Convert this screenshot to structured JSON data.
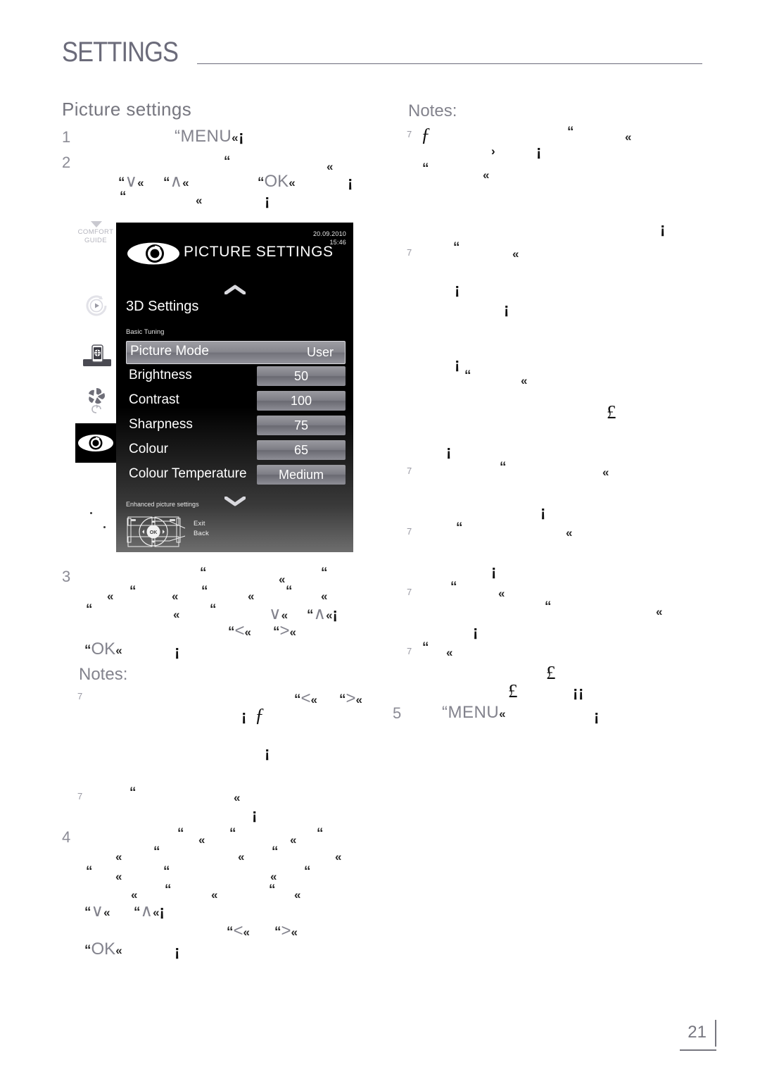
{
  "header": {
    "title": "SETTINGS",
    "rule": "horizontal-rule"
  },
  "section": {
    "heading": "Picture settings"
  },
  "page_number": "21",
  "left_column": {
    "steps": [
      "1",
      "2",
      "3",
      "4"
    ],
    "notes_label": "Notes:",
    "keys": {
      "menu": "MENU",
      "ok": "OK",
      "down": "∨",
      "up": "∧",
      "left": "<",
      "right": ">"
    },
    "glyphs": {
      "quote_open": "“",
      "quote_close": "«",
      "inverted_exclam": "¡",
      "note_marker": "7",
      "florin": "ƒ"
    }
  },
  "right_column": {
    "notes_label": "Notes:",
    "steps": [
      "5"
    ],
    "keys": {
      "menu": "MENU"
    },
    "glyphs": {
      "quote_open": "“",
      "quote_close": "«",
      "inverted_exclam": "¡",
      "note_marker": "7",
      "florin": "ƒ",
      "pound": "£",
      "single_angle": "›"
    }
  },
  "tv_screenshot": {
    "sidebar": {
      "comfort_guide_line1": "COMFORT",
      "comfort_guide_line2": "GUIDE",
      "icons": [
        "down-triangle-icon",
        "play-circle-icon",
        "network-device-icon",
        "fan-icon",
        "eye-icon"
      ]
    },
    "header": {
      "title": "PICTURE SETTINGS",
      "date": "20.09.2010",
      "time": "15:46",
      "logo": "eye-icon"
    },
    "submenu_title": "3D Settings",
    "group_label": "Basic Tuning",
    "rows": [
      {
        "label": "Picture Mode",
        "value": "User",
        "selected": true
      },
      {
        "label": "Brightness",
        "value": "50",
        "selected": false
      },
      {
        "label": "Contrast",
        "value": "100",
        "selected": false
      },
      {
        "label": "Sharpness",
        "value": "75",
        "selected": false
      },
      {
        "label": "Colour",
        "value": "65",
        "selected": false
      },
      {
        "label": "Colour Temperature",
        "value": "Medium",
        "selected": false
      }
    ],
    "footer_label": "Enhanced picture settings",
    "remote": {
      "ok_label": "OK",
      "exit_label": "Exit",
      "back_label": "Back"
    },
    "scroll_up_icon": "chevron-up-icon",
    "scroll_down_icon": "chevron-down-icon"
  }
}
